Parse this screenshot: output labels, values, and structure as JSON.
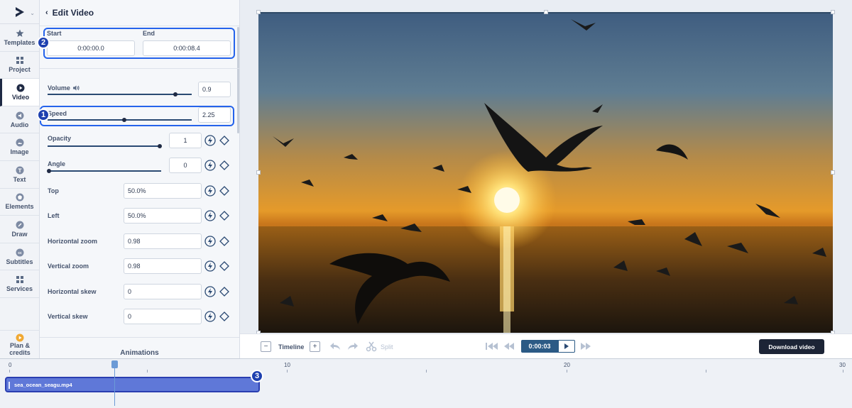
{
  "panel": {
    "title": "Edit Video",
    "start_label": "Start",
    "end_label": "End",
    "start_value": "0:00:00.0",
    "end_value": "0:00:08.4",
    "volume_label": "Volume",
    "volume_value": "0.9",
    "speed_label": "Speed",
    "speed_value": "2.25",
    "opacity_label": "Opacity",
    "opacity_value": "1",
    "angle_label": "Angle",
    "angle_value": "0",
    "top_label": "Top",
    "top_value": "50.0%",
    "left_label": "Left",
    "left_value": "50.0%",
    "hzoom_label": "Horizontal zoom",
    "hzoom_value": "0.98",
    "vzoom_label": "Vertical zoom",
    "vzoom_value": "0.98",
    "hskew_label": "Horizontal skew",
    "hskew_value": "0",
    "vskew_label": "Vertical skew",
    "vskew_value": "0",
    "animations_label": "Animations"
  },
  "rail": {
    "items": [
      {
        "label": "Templates",
        "icon": "star-icon"
      },
      {
        "label": "Project",
        "icon": "grid-icon"
      },
      {
        "label": "Video",
        "icon": "play-circle-icon"
      },
      {
        "label": "Audio",
        "icon": "audio-icon"
      },
      {
        "label": "Image",
        "icon": "image-icon"
      },
      {
        "label": "Text",
        "icon": "text-icon"
      },
      {
        "label": "Elements",
        "icon": "elements-icon"
      },
      {
        "label": "Draw",
        "icon": "pencil-icon"
      },
      {
        "label": "Subtitles",
        "icon": "cc-icon"
      },
      {
        "label": "Services",
        "icon": "services-icon"
      }
    ],
    "plan_label_1": "Plan &",
    "plan_label_2": "credits"
  },
  "annotations": {
    "one": "1",
    "two": "2",
    "three": "3"
  },
  "controls": {
    "minus": "−",
    "timeline_label": "Timeline",
    "plus": "+",
    "split_label": "Split",
    "current_time": "0:00:03",
    "download_label": "Download video"
  },
  "timeline": {
    "marks": [
      "0",
      "10",
      "20",
      "30"
    ],
    "clip_name": "sea_ocean_seagu.mp4"
  },
  "sliders": {
    "volume": 0.9,
    "speed": 0.5,
    "opacity": 1.0,
    "angle": 0.0
  },
  "colors": {
    "accent": "#2563eb",
    "clip": "#5f78d8",
    "dark": "#1c2436"
  }
}
